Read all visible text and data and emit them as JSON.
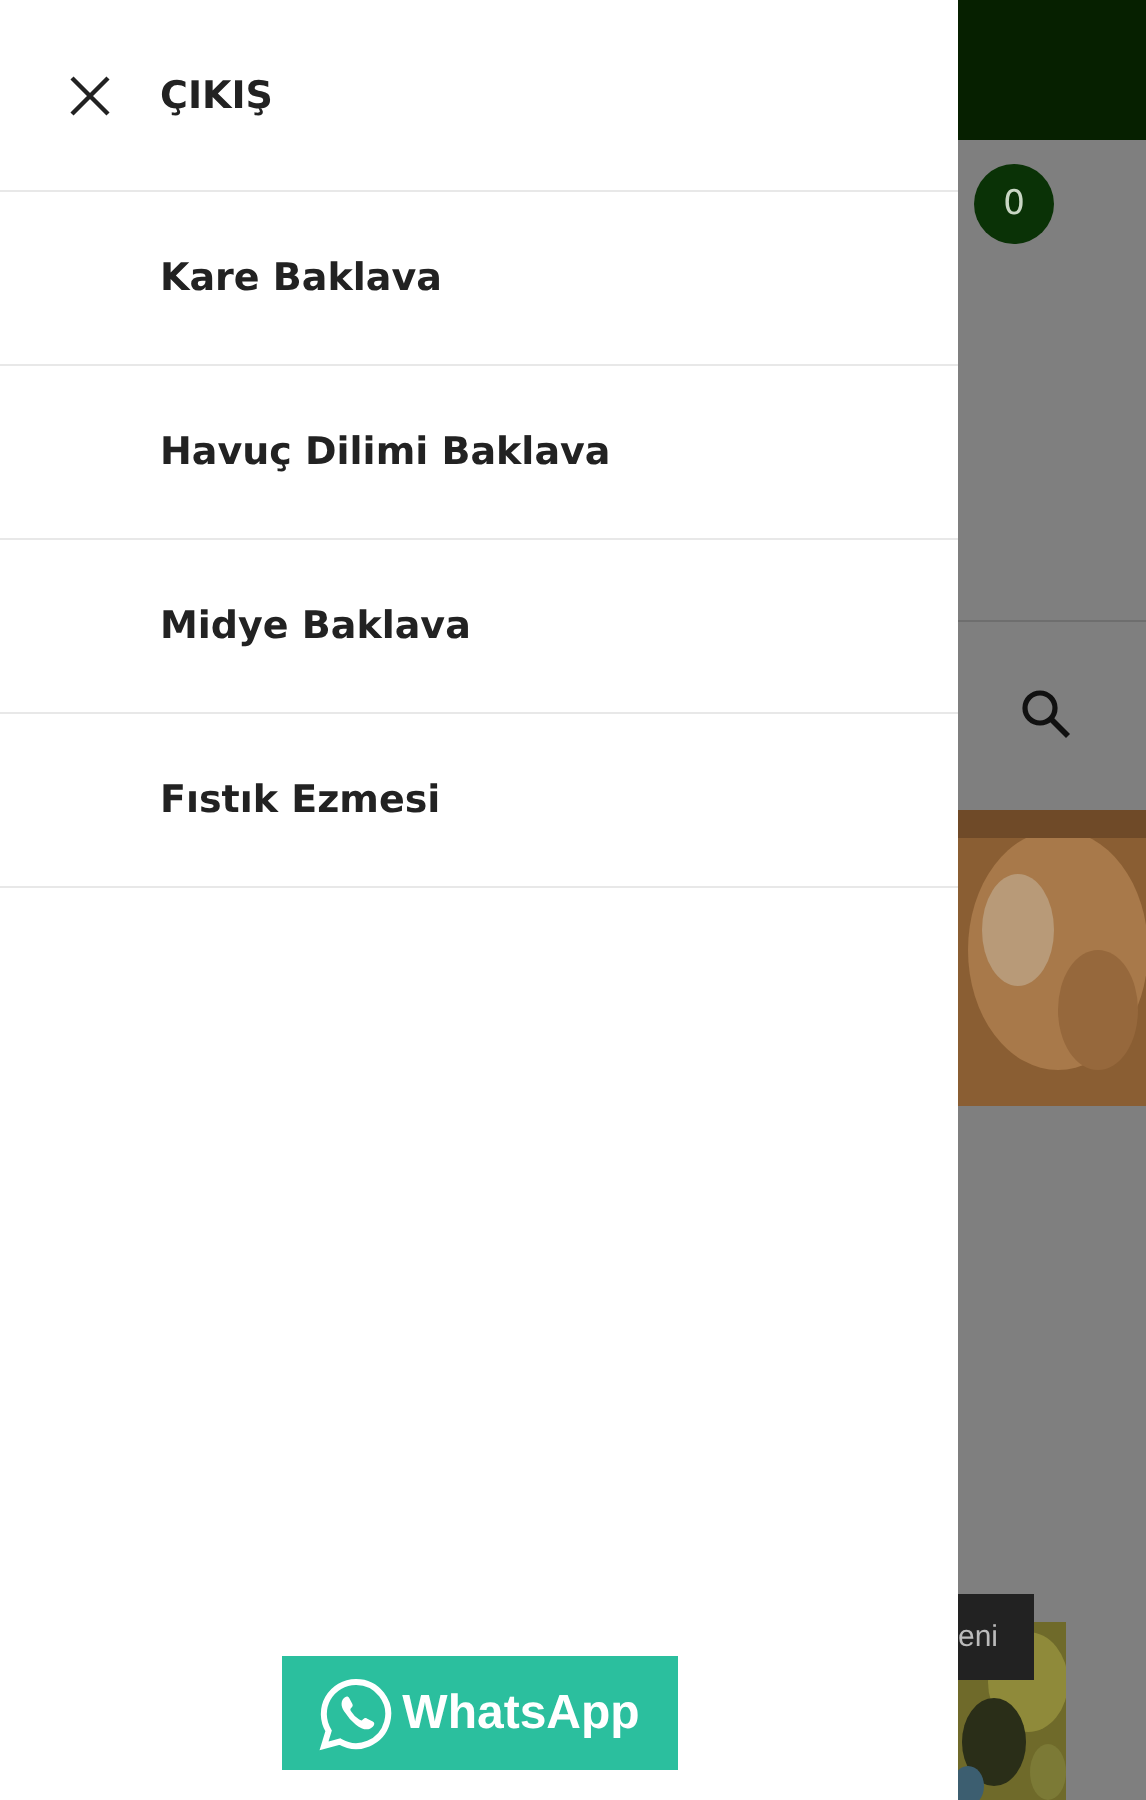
{
  "drawer": {
    "close_label": "ÇIKIŞ",
    "items": [
      {
        "label": "Kare Baklava"
      },
      {
        "label": "Havuç Dilimi Baklava"
      },
      {
        "label": "Midye Baklava"
      },
      {
        "label": "Fıstık Ezmesi"
      }
    ],
    "whatsapp_label": "WhatsApp"
  },
  "background_page": {
    "cart_count": "0",
    "tag": "eni"
  }
}
